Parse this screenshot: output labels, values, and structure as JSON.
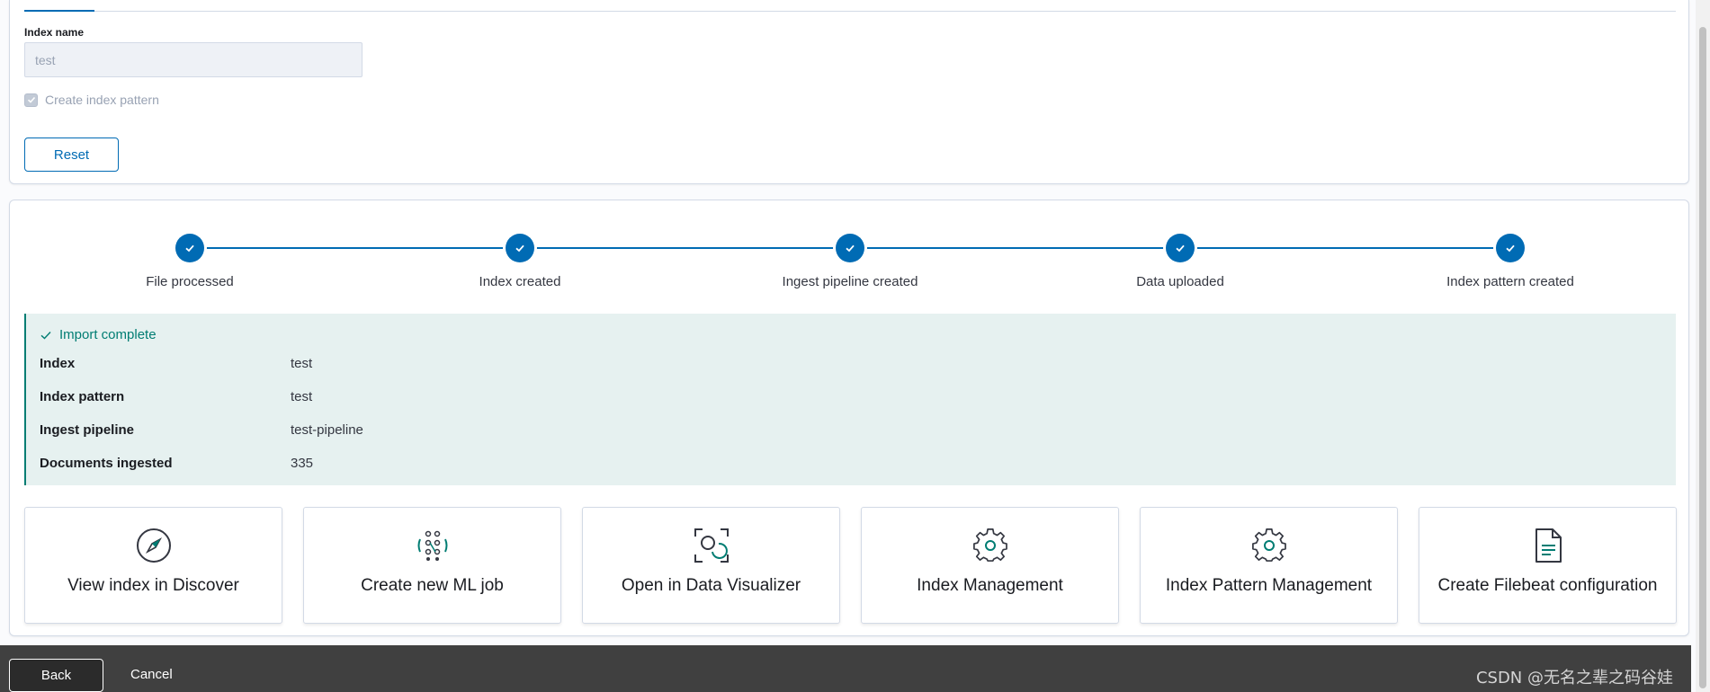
{
  "top_panel": {
    "index_name_label": "Index name",
    "index_name_value": "test",
    "create_index_pattern_label": "Create index pattern",
    "create_index_pattern_checked": true,
    "reset_label": "Reset"
  },
  "steps": [
    {
      "label": "File processed",
      "done": true
    },
    {
      "label": "Index created",
      "done": true
    },
    {
      "label": "Ingest pipeline created",
      "done": true
    },
    {
      "label": "Data uploaded",
      "done": true
    },
    {
      "label": "Index pattern created",
      "done": true
    }
  ],
  "import_result": {
    "title": "Import complete",
    "rows": [
      {
        "key": "Index",
        "value": "test"
      },
      {
        "key": "Index pattern",
        "value": "test"
      },
      {
        "key": "Ingest pipeline",
        "value": "test-pipeline"
      },
      {
        "key": "Documents ingested",
        "value": "335"
      }
    ]
  },
  "actions": [
    {
      "label": "View index in Discover",
      "icon": "compass-icon"
    },
    {
      "label": "Create new ML job",
      "icon": "ml-job-icon"
    },
    {
      "label": "Open in Data Visualizer",
      "icon": "data-visualizer-icon"
    },
    {
      "label": "Index Management",
      "icon": "gear-icon"
    },
    {
      "label": "Index Pattern Management",
      "icon": "gear-icon"
    },
    {
      "label": "Create Filebeat configuration",
      "icon": "document-icon"
    }
  ],
  "bottom_bar": {
    "back_label": "Back",
    "cancel_label": "Cancel",
    "watermark": "CSDN @无名之辈之码谷娃"
  },
  "colors": {
    "primary": "#006bb4",
    "success": "#017d73",
    "callout_bg": "#e6f1f0",
    "bottom_bar": "#404040"
  }
}
